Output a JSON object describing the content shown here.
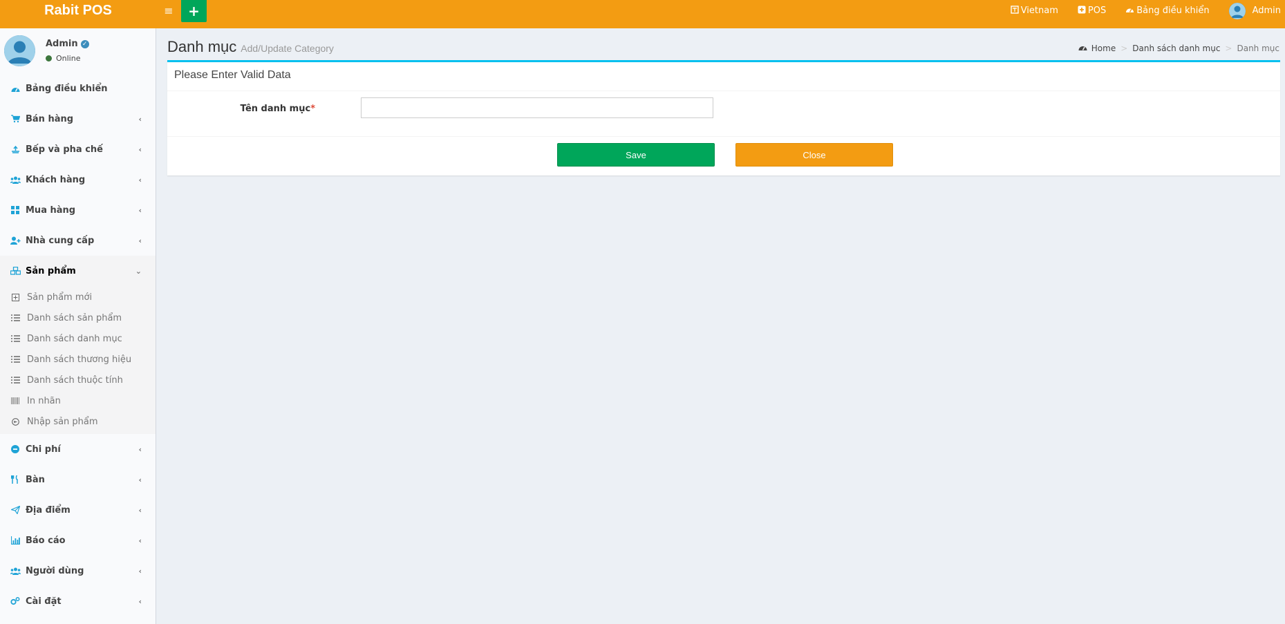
{
  "header": {
    "brand": "Rabit POS",
    "links": {
      "language": "Vietnam",
      "pos": "POS",
      "dashboard": "Bảng điều khiển",
      "user": "Admin"
    }
  },
  "sidebar": {
    "user": {
      "name": "Admin",
      "status": "Online"
    },
    "items_top": [
      {
        "label": "Bảng điều khiển",
        "icon": "dashboard-icon"
      },
      {
        "label": "Bán hàng",
        "icon": "cart-icon"
      },
      {
        "label": "Bếp và pha chế",
        "icon": "kitchen-icon"
      },
      {
        "label": "Khách hàng",
        "icon": "users-icon"
      },
      {
        "label": "Mua hàng",
        "icon": "grid-icon"
      },
      {
        "label": "Nhà cung cấp",
        "icon": "user-plus-icon"
      },
      {
        "label": "Sản phẩm",
        "icon": "cubes-icon"
      }
    ],
    "submenu": [
      {
        "label": "Sản phẩm mới"
      },
      {
        "label": "Danh sách sản phẩm"
      },
      {
        "label": "Danh sách danh mục"
      },
      {
        "label": "Danh sách thương hiệu"
      },
      {
        "label": "Danh sách thuộc tính"
      },
      {
        "label": "In nhãn"
      },
      {
        "label": "Nhập sản phẩm"
      }
    ],
    "items_bottom": [
      {
        "label": "Chi phí"
      },
      {
        "label": "Bàn"
      },
      {
        "label": "Địa điểm"
      },
      {
        "label": "Báo cáo"
      },
      {
        "label": "Người dùng"
      },
      {
        "label": "Cài đặt"
      }
    ]
  },
  "content": {
    "title": "Danh mục",
    "subtitle": "Add/Update Category",
    "breadcrumb": [
      "Home",
      "Danh sách danh mục",
      "Danh mục"
    ],
    "box_title": "Please Enter Valid Data",
    "field_label": "Tên danh mục",
    "field_required": "*",
    "field_value": "",
    "save_label": "Save",
    "close_label": "Close"
  },
  "colors": {
    "header": "#f39c12",
    "save": "#00a65a",
    "close": "#f39c12",
    "box_border": "#00c0ef",
    "icon_accent": "#1fa3d6"
  }
}
